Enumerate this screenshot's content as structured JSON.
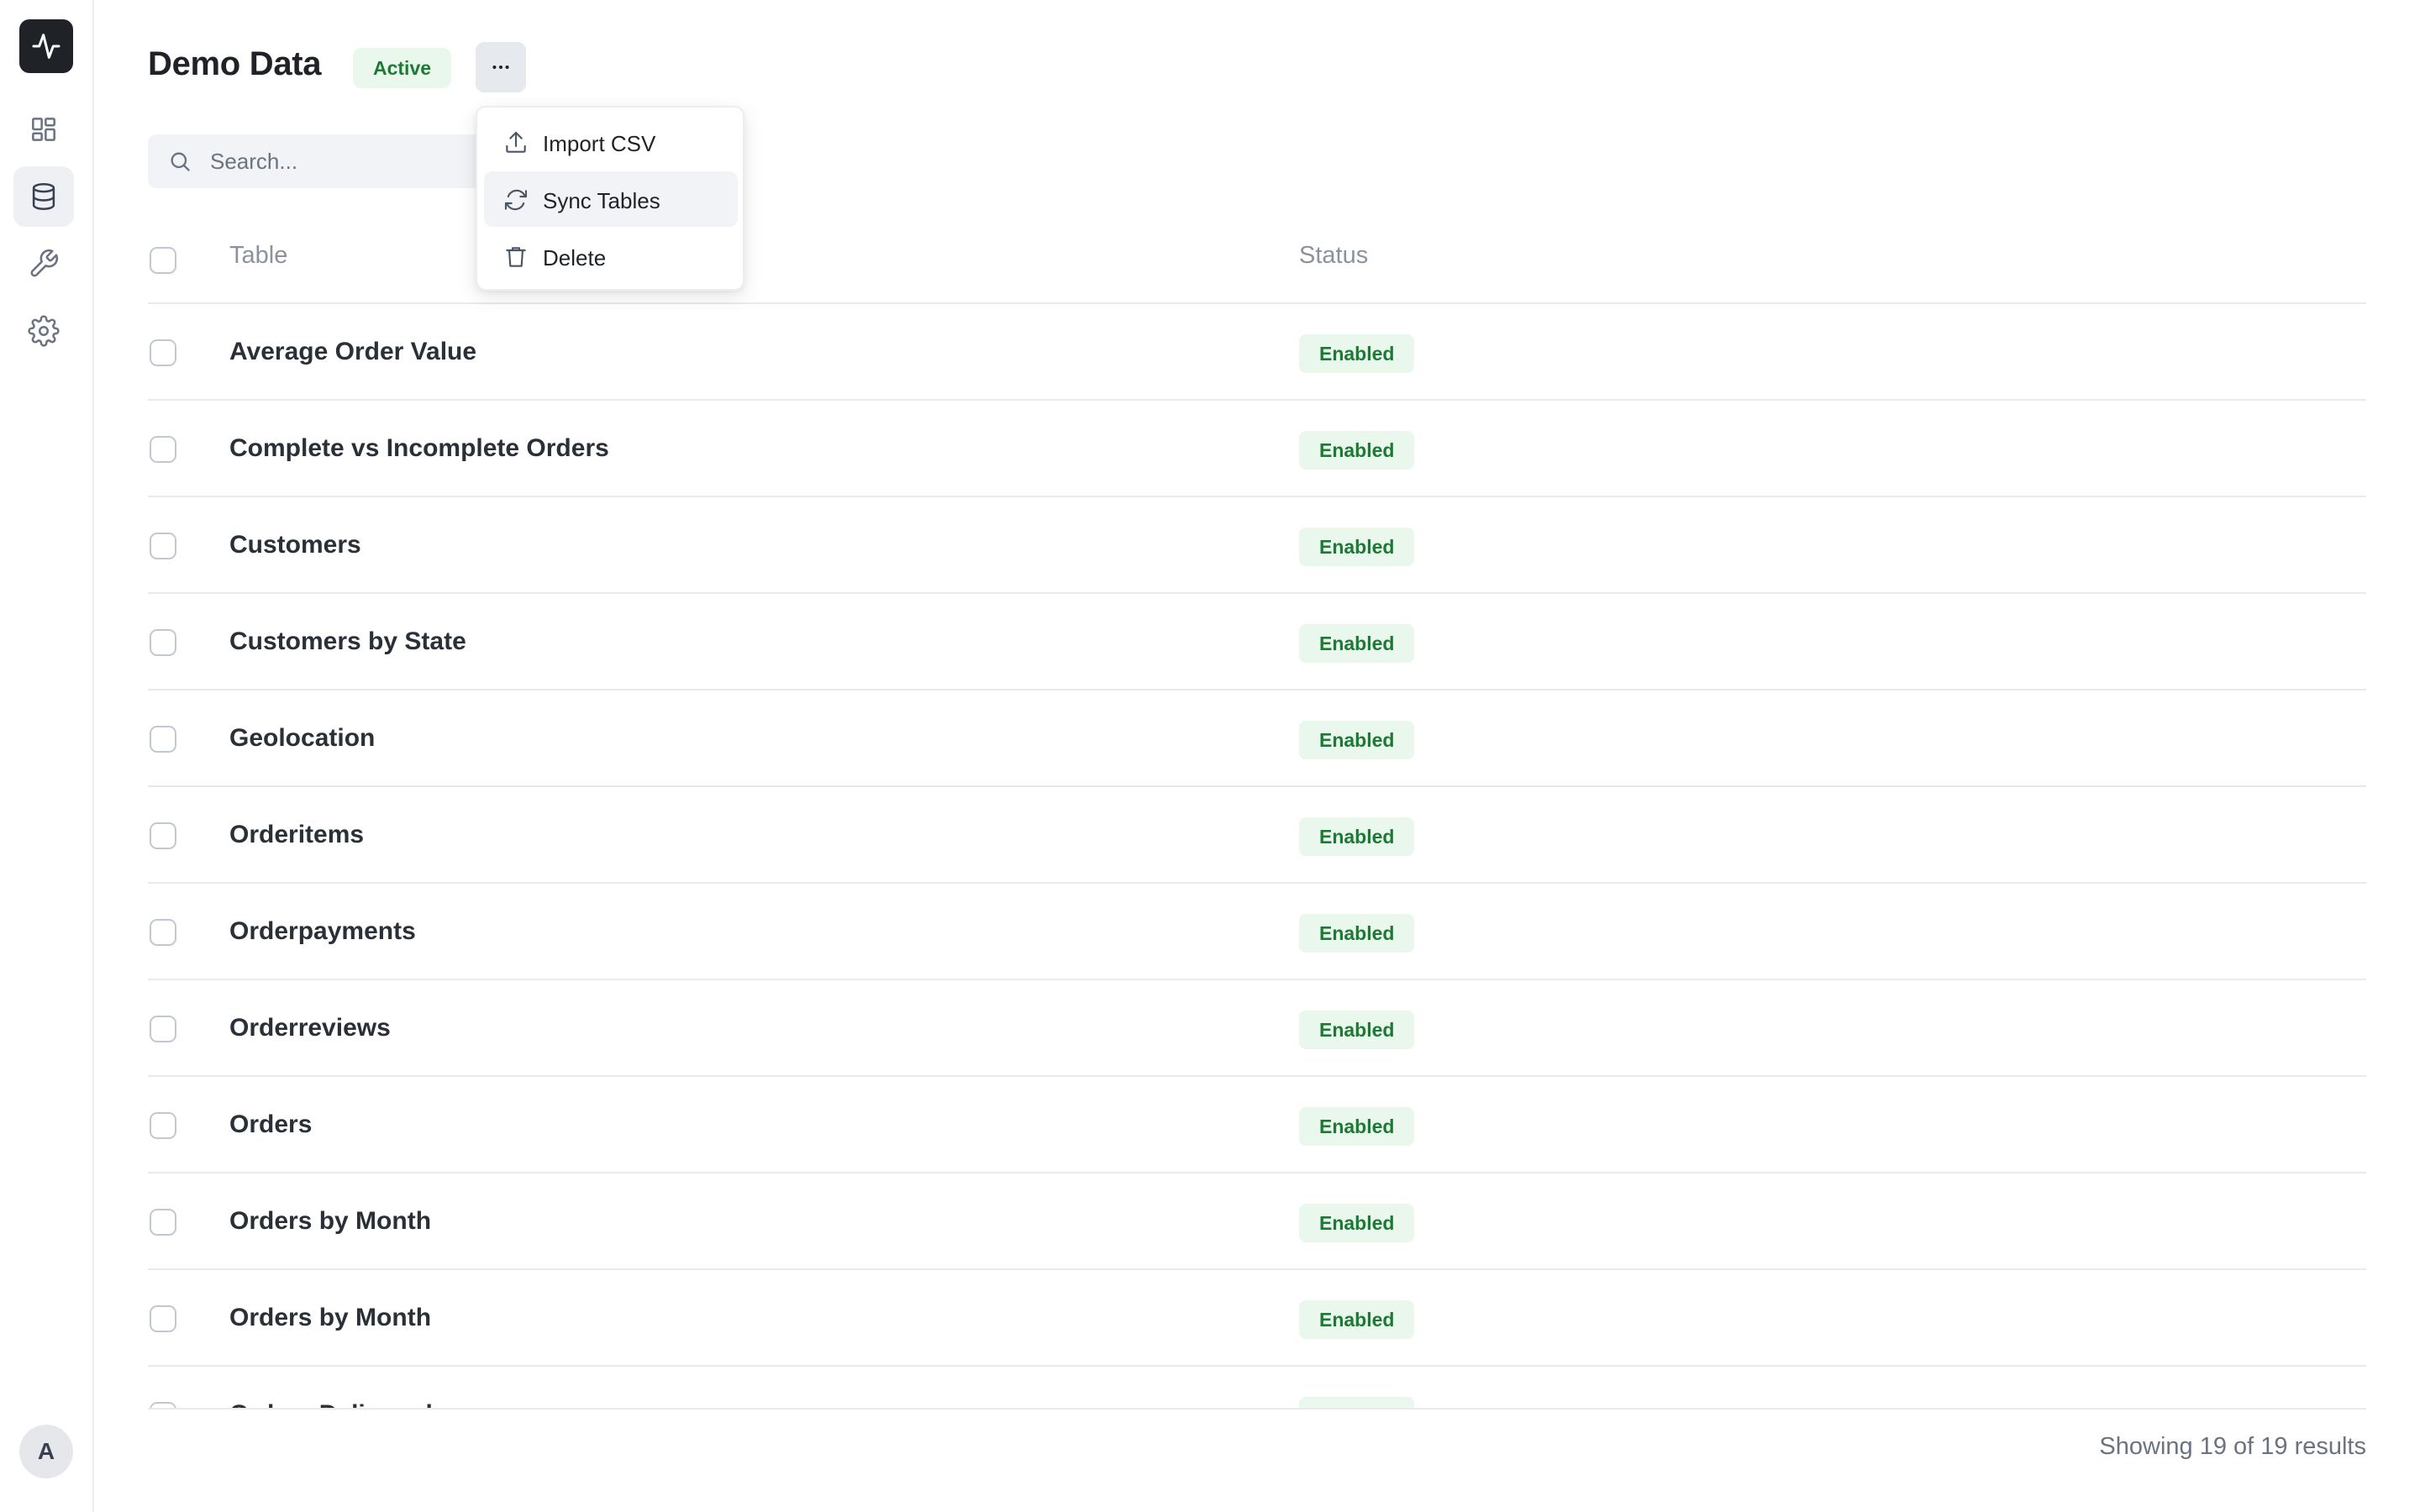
{
  "page": {
    "title": "Demo Data",
    "status_badge": "Active"
  },
  "search": {
    "placeholder": "Search..."
  },
  "menu": {
    "items": [
      {
        "label": "Import CSV",
        "icon": "upload-icon"
      },
      {
        "label": "Sync Tables",
        "icon": "refresh-icon",
        "highlighted": true
      },
      {
        "label": "Delete",
        "icon": "trash-icon"
      }
    ]
  },
  "table": {
    "headers": {
      "name": "Table",
      "status": "Status"
    },
    "rows": [
      {
        "name": "Average Order Value",
        "status": "Enabled"
      },
      {
        "name": "Complete vs Incomplete Orders",
        "status": "Enabled"
      },
      {
        "name": "Customers",
        "status": "Enabled"
      },
      {
        "name": "Customers by State",
        "status": "Enabled"
      },
      {
        "name": "Geolocation",
        "status": "Enabled"
      },
      {
        "name": "Orderitems",
        "status": "Enabled"
      },
      {
        "name": "Orderpayments",
        "status": "Enabled"
      },
      {
        "name": "Orderreviews",
        "status": "Enabled"
      },
      {
        "name": "Orders",
        "status": "Enabled"
      },
      {
        "name": "Orders by Month",
        "status": "Enabled"
      },
      {
        "name": "Orders by Month",
        "status": "Enabled"
      },
      {
        "name": "Orders Delivered",
        "status": "Enabled"
      }
    ]
  },
  "footer": {
    "results_text": "Showing 19 of 19 results"
  },
  "sidebar": {
    "avatar_initial": "A",
    "items": [
      {
        "icon": "dashboard-icon",
        "active": false
      },
      {
        "icon": "database-icon",
        "active": true
      },
      {
        "icon": "wrench-icon",
        "active": false
      },
      {
        "icon": "gear-icon",
        "active": false
      }
    ]
  },
  "colors": {
    "accent_green_bg": "#eaf7ec",
    "accent_green_text": "#1c7a35",
    "logo_bg": "#1f2328"
  }
}
